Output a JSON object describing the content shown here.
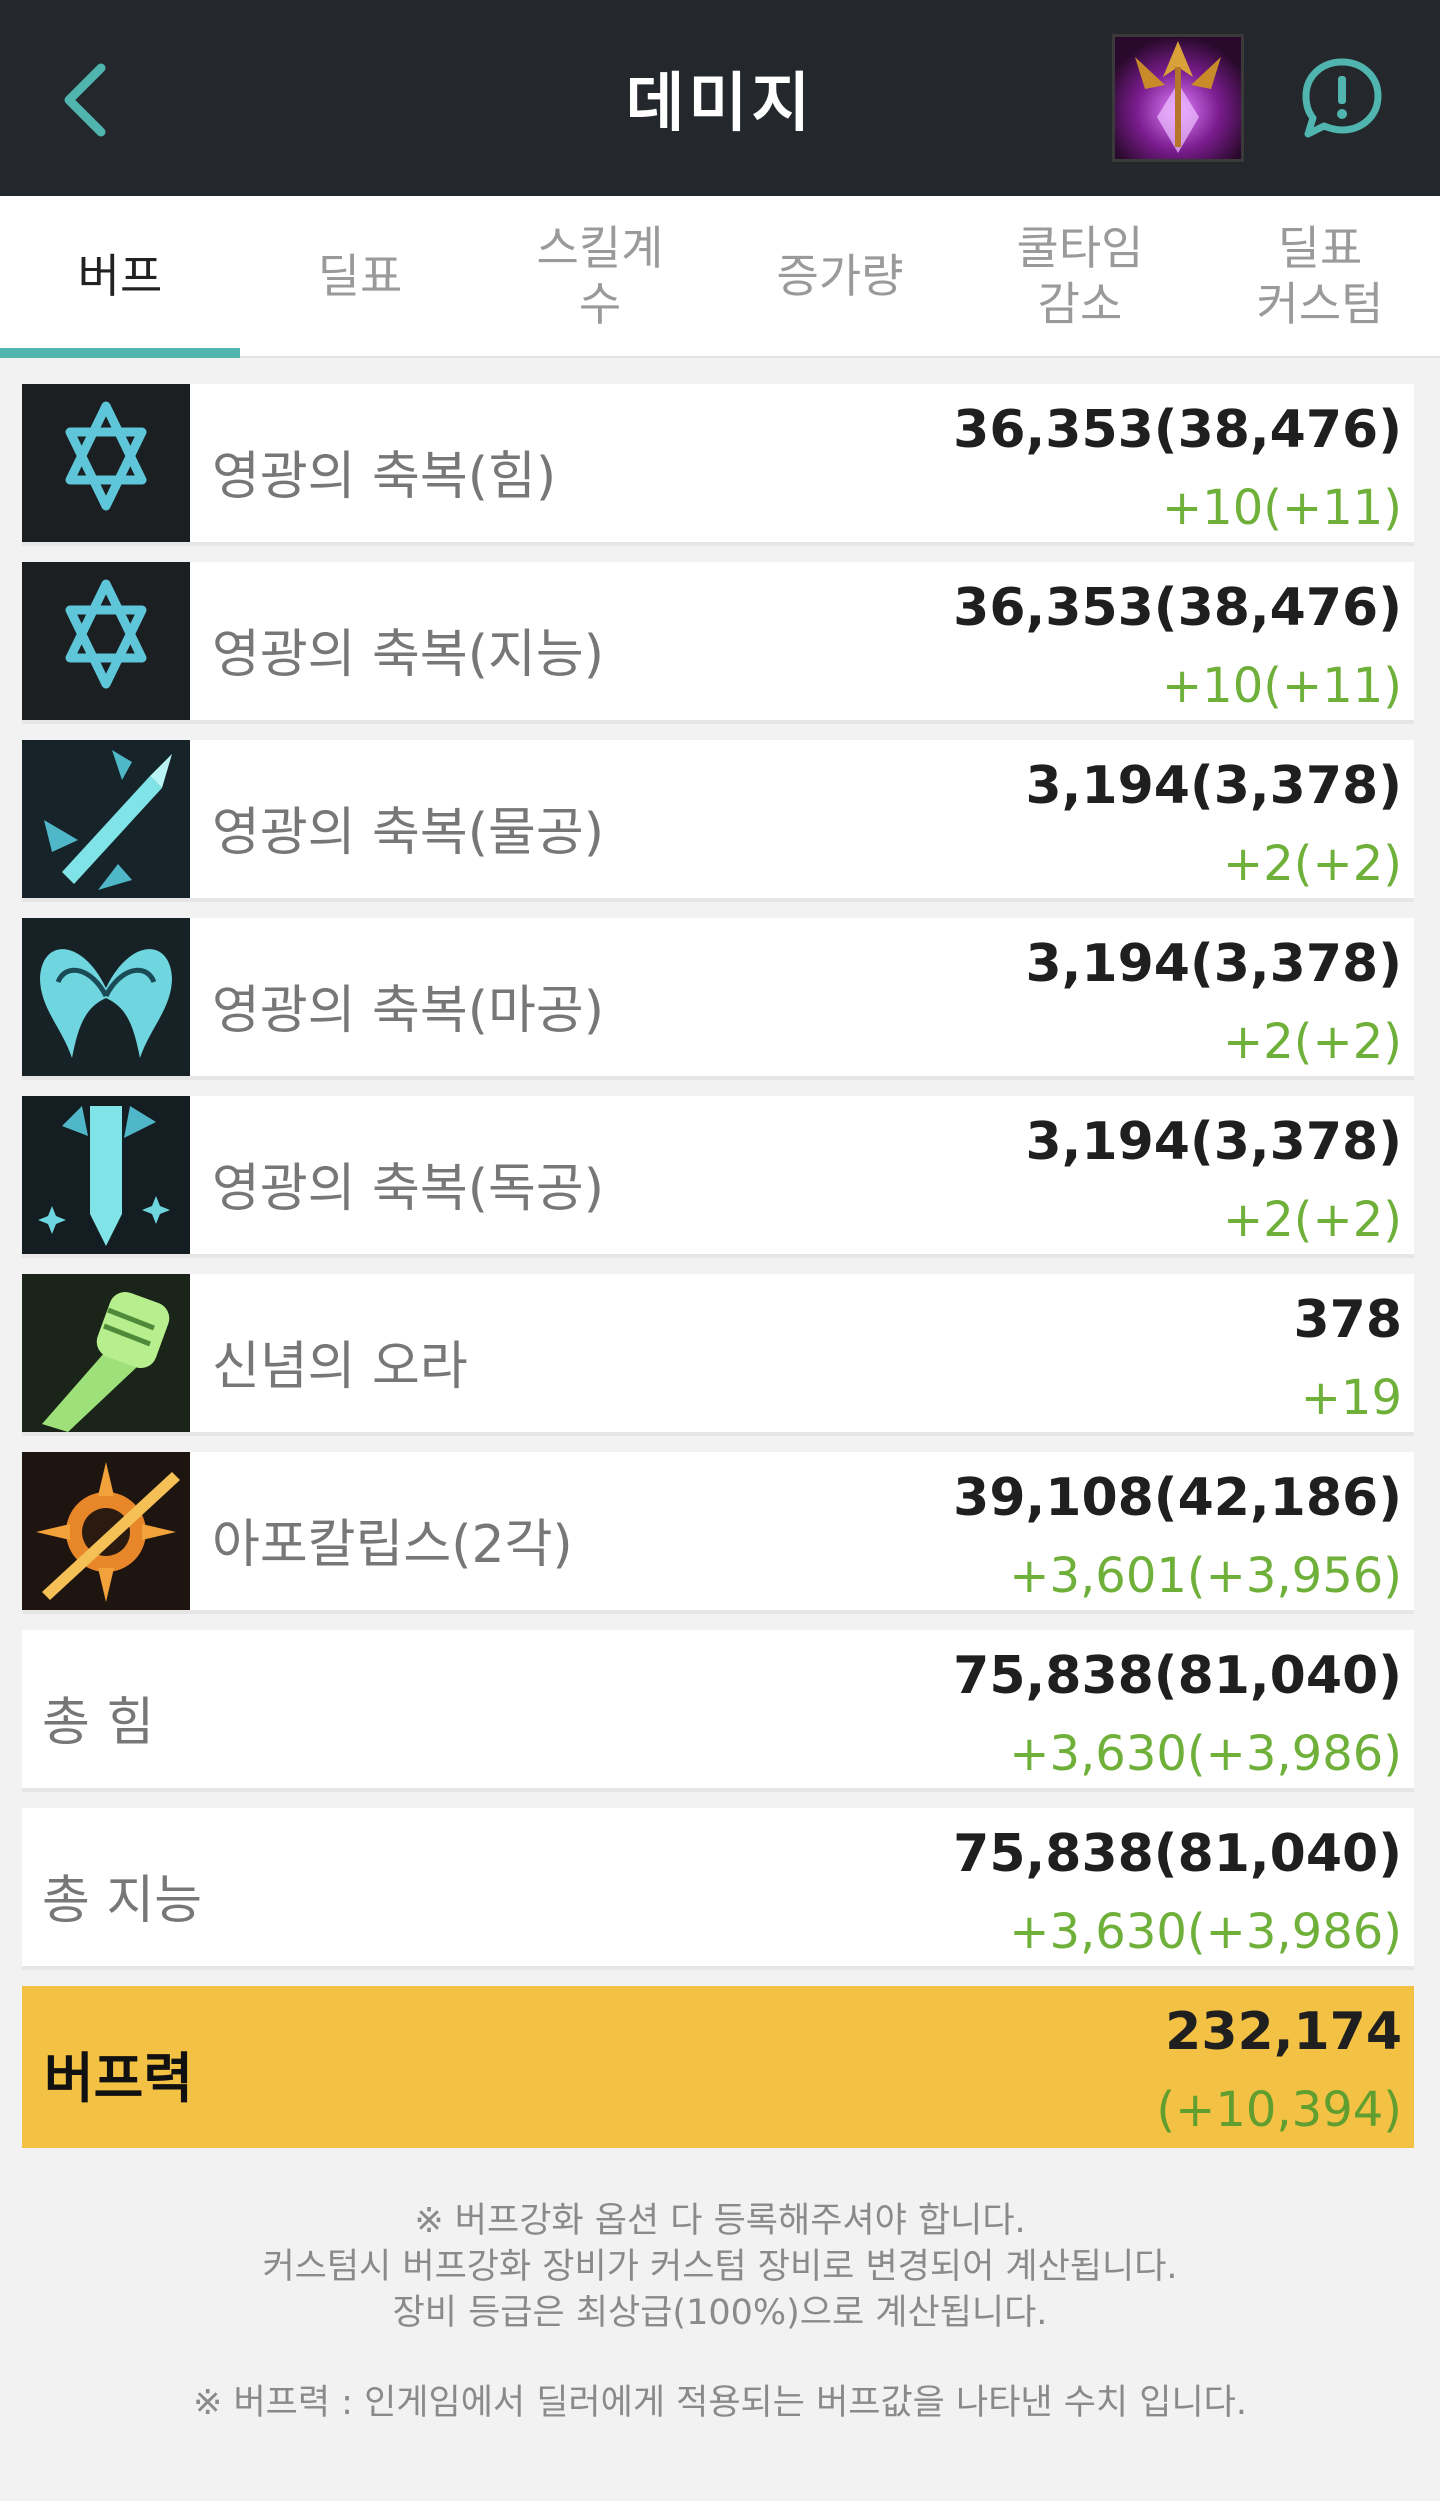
{
  "header": {
    "title": "데미지",
    "back_icon": "chevron-left-icon",
    "info_icon": "alert-chat-icon",
    "accent": "#4fb5ae"
  },
  "tabs": [
    {
      "label": "버프",
      "active": true
    },
    {
      "label": "딜표",
      "active": false
    },
    {
      "label": "스킬계\n수",
      "active": false
    },
    {
      "label": "증가량",
      "active": false
    },
    {
      "label": "쿨타임\n감소",
      "active": false
    },
    {
      "label": "딜표\n커스텀",
      "active": false
    }
  ],
  "rows": [
    {
      "icon": "hexagram-icon",
      "label": "영광의 축복(힘)",
      "value": "36,353(38,476)",
      "diff": "+10(+11)"
    },
    {
      "icon": "hexagram-icon",
      "label": "영광의 축복(지능)",
      "value": "36,353(38,476)",
      "diff": "+10(+11)"
    },
    {
      "icon": "sword-icon",
      "label": "영광의 축복(물공)",
      "value": "3,194(3,378)",
      "diff": "+2(+2)"
    },
    {
      "icon": "wings-icon",
      "label": "영광의 축복(마공)",
      "value": "3,194(3,378)",
      "diff": "+2(+2)"
    },
    {
      "icon": "blade-sparkle-icon",
      "label": "영광의 축복(독공)",
      "value": "3,194(3,378)",
      "diff": "+2(+2)"
    },
    {
      "icon": "raised-fist-icon",
      "label": "신념의 오라",
      "value": "378",
      "diff": "+19"
    },
    {
      "icon": "apocalypse-burst-icon",
      "label": "아포칼립스(2각)",
      "value": "39,108(42,186)",
      "diff": "+3,601(+3,956)"
    }
  ],
  "totals": [
    {
      "label": "총 힘",
      "value": "75,838(81,040)",
      "diff": "+3,630(+3,986)"
    },
    {
      "label": "총 지능",
      "value": "75,838(81,040)",
      "diff": "+3,630(+3,986)"
    }
  ],
  "summary": {
    "label": "버프력",
    "value": "232,174",
    "diff": "(+10,394)",
    "color": "#f3c244"
  },
  "notes": {
    "line1": "※ 버프강화 옵션 다 등록해주셔야 합니다.",
    "line2": "커스텀시 버프강화 장비가 커스텀 장비로 변경되어 계산됩니다.",
    "line3": "장비 등급은 최상급(100%)으로 계산됩니다.",
    "line4": "※ 버프력 : 인게임에서 딜러에게 적용되는 버프값을 나타낸 수치 입니다."
  }
}
